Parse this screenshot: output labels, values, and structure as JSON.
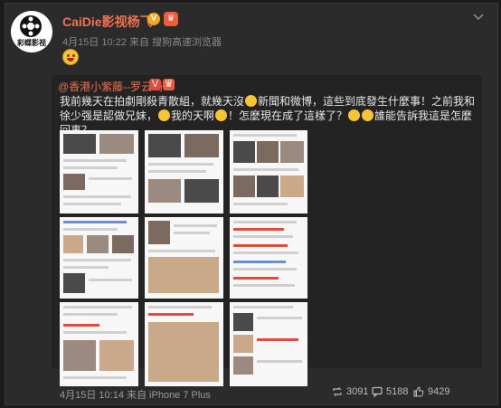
{
  "post": {
    "username": "CaiDie影视杨飞",
    "avatar_text": "彩蝶影视",
    "v_badge": "V",
    "crown_badge": "冠",
    "meta": "4月15日 10:22 来自 搜狗高速浏览器"
  },
  "quoted": {
    "mention": "@香港小紫藤--罗云琦",
    "text_part1": "我前幾天在拍劇剛殺青散組，就幾天沒",
    "text_part2": "新聞和微博，這些到底發生什麼事！之前我和徐少强是認做兄妹，",
    "text_part3": "我的天啊",
    "text_part4": "！怎麼現在成了這樣了？",
    "text_part5": "誰能告訴我這是怎麼回事？"
  },
  "footer": {
    "meta": "4月15日 10:14 来自 iPhone 7 Plus",
    "reposts": "3091",
    "comments": "5188",
    "likes": "9429"
  },
  "colors": {
    "accent": "#eb7350",
    "link": "#7aa7d8",
    "background": "#2b2b2b"
  }
}
